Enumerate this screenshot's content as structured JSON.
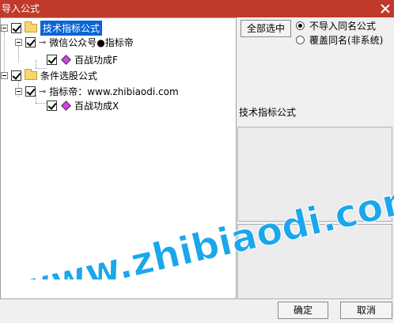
{
  "window": {
    "title": "导入公式"
  },
  "tree": {
    "nodes": [
      {
        "label": "技术指标公式",
        "kind": "folder",
        "selected": true
      },
      {
        "label": "微信公众号●指标帝",
        "kind": "key"
      },
      {
        "label": "百战功成F",
        "kind": "formula"
      },
      {
        "label": "条件选股公式",
        "kind": "folder"
      },
      {
        "label": "指标帝：www.zhibiaodi.com",
        "kind": "key"
      },
      {
        "label": "百战功成X",
        "kind": "formula"
      }
    ]
  },
  "options": {
    "select_all_label": "全部选中",
    "radio_no_import": "不导入同名公式",
    "radio_overwrite": "覆盖同名(非系统)",
    "selected_radio": "no_import"
  },
  "info": {
    "type_label": "技术指标公式"
  },
  "watermark": {
    "text": "www.zhibiaodi.com"
  },
  "footer": {
    "ok_label": "确定",
    "cancel_label": "取消"
  },
  "colors": {
    "titlebar": "#c0392b",
    "selection": "#0a64d6",
    "watermark": "#1aa7ec"
  },
  "icons": [
    "close-icon",
    "folder-icon",
    "key-icon",
    "formula-icon",
    "checkbox-icon",
    "expander-icon",
    "radio-icon"
  ]
}
